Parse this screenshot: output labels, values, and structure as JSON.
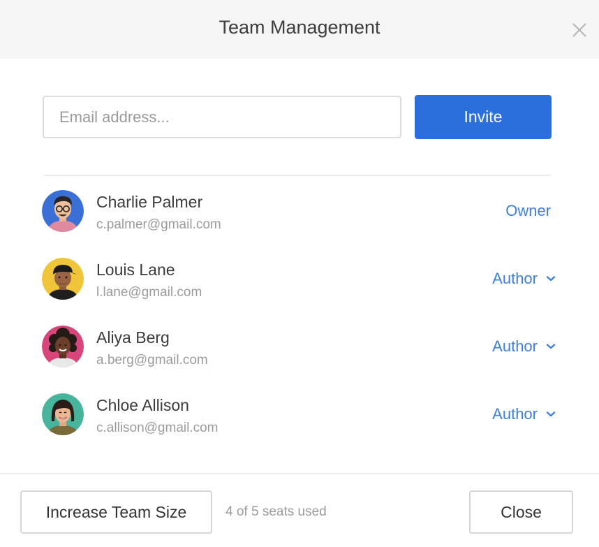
{
  "dialog": {
    "title": "Team Management"
  },
  "invite": {
    "placeholder": "Email address...",
    "value": "",
    "button_label": "Invite"
  },
  "members": [
    {
      "name": "Charlie Palmer",
      "email": "c.palmer@gmail.com",
      "role": "Owner",
      "role_editable": false,
      "avatar_icon": "avatar-man-glasses",
      "avatar_bg": "#3a6fd8"
    },
    {
      "name": "Louis Lane",
      "email": "l.lane@gmail.com",
      "role": "Author",
      "role_editable": true,
      "avatar_icon": "avatar-man-cap",
      "avatar_bg": "#f1c53a"
    },
    {
      "name": "Aliya Berg",
      "email": "a.berg@gmail.com",
      "role": "Author",
      "role_editable": true,
      "avatar_icon": "avatar-woman-curly",
      "avatar_bg": "#d8457a"
    },
    {
      "name": "Chloe Allison",
      "email": "c.allison@gmail.com",
      "role": "Author",
      "role_editable": true,
      "avatar_icon": "avatar-woman-smile",
      "avatar_bg": "#47b59b"
    }
  ],
  "footer": {
    "increase_label": "Increase Team Size",
    "seats_text": "4 of 5 seats used",
    "close_label": "Close"
  },
  "colors": {
    "accent": "#2a6fdc",
    "role_text": "#3d7ee0",
    "header_bg": "#f5f5f5"
  }
}
